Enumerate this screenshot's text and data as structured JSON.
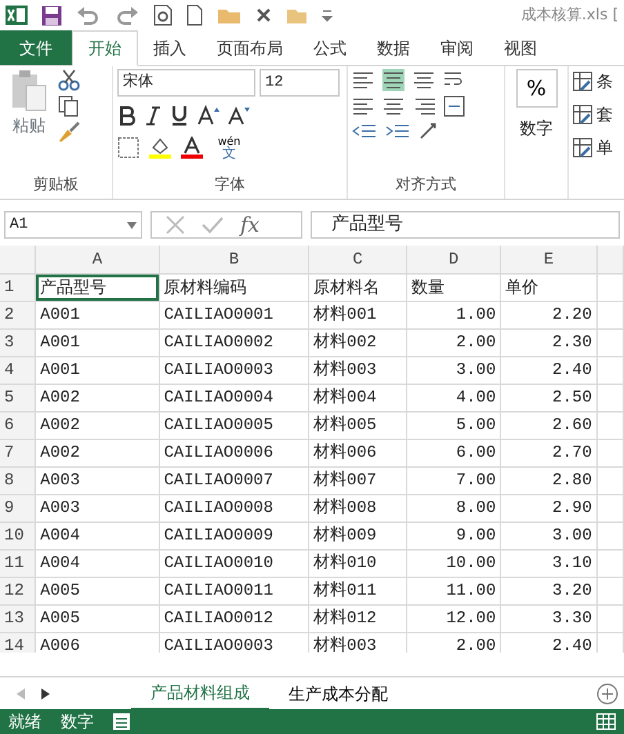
{
  "window": {
    "title": "成本核算.xls ["
  },
  "ribbon_tabs": [
    {
      "label": "文件",
      "kind": "file",
      "selected": false
    },
    {
      "label": "开始",
      "kind": "tab",
      "selected": true
    },
    {
      "label": "插入",
      "kind": "tab",
      "selected": false
    },
    {
      "label": "页面布局",
      "kind": "tab",
      "selected": false
    },
    {
      "label": "公式",
      "kind": "tab",
      "selected": false
    },
    {
      "label": "数据",
      "kind": "tab",
      "selected": false
    },
    {
      "label": "审阅",
      "kind": "tab",
      "selected": false
    },
    {
      "label": "视图",
      "kind": "tab",
      "selected": false
    }
  ],
  "ribbon": {
    "paste_label": "粘贴",
    "font_name": "宋体",
    "font_size": "12",
    "phonetic_label": "wén",
    "phonetic_char": "文",
    "number_symbol": "%",
    "number_label": "数字",
    "styles": [
      "条",
      "套",
      "单"
    ],
    "groups": [
      "剪贴板",
      "字体",
      "对齐方式"
    ]
  },
  "formula_bar": {
    "name_box": "A1",
    "fx": "fx",
    "formula": "产品型号"
  },
  "sheet": {
    "columns": [
      "A",
      "B",
      "C",
      "D",
      "E"
    ],
    "rows": [
      {
        "n": "1",
        "cells": [
          "产品型号",
          "原材料编码",
          "原材料名",
          "数量",
          "单价"
        ]
      },
      {
        "n": "2",
        "cells": [
          "A001",
          "CAILIAO0001",
          "材料001",
          "1.00",
          "2.20"
        ]
      },
      {
        "n": "3",
        "cells": [
          "A001",
          "CAILIAO0002",
          "材料002",
          "2.00",
          "2.30"
        ]
      },
      {
        "n": "4",
        "cells": [
          "A001",
          "CAILIAO0003",
          "材料003",
          "3.00",
          "2.40"
        ]
      },
      {
        "n": "5",
        "cells": [
          "A002",
          "CAILIAO0004",
          "材料004",
          "4.00",
          "2.50"
        ]
      },
      {
        "n": "6",
        "cells": [
          "A002",
          "CAILIAO0005",
          "材料005",
          "5.00",
          "2.60"
        ]
      },
      {
        "n": "7",
        "cells": [
          "A002",
          "CAILIAO0006",
          "材料006",
          "6.00",
          "2.70"
        ]
      },
      {
        "n": "8",
        "cells": [
          "A003",
          "CAILIAO0007",
          "材料007",
          "7.00",
          "2.80"
        ]
      },
      {
        "n": "9",
        "cells": [
          "A003",
          "CAILIAO0008",
          "材料008",
          "8.00",
          "2.90"
        ]
      },
      {
        "n": "10",
        "cells": [
          "A004",
          "CAILIAO0009",
          "材料009",
          "9.00",
          "3.00"
        ]
      },
      {
        "n": "11",
        "cells": [
          "A004",
          "CAILIAO0010",
          "材料010",
          "10.00",
          "3.10"
        ]
      },
      {
        "n": "12",
        "cells": [
          "A005",
          "CAILIAO0011",
          "材料011",
          "11.00",
          "3.20"
        ]
      },
      {
        "n": "13",
        "cells": [
          "A005",
          "CAILIAO0012",
          "材料012",
          "12.00",
          "3.30"
        ]
      },
      {
        "n": "14",
        "cells": [
          "A006",
          "CAILIAO0003",
          "材料003",
          "2.00",
          "2.40"
        ]
      }
    ]
  },
  "sheet_tabs": [
    {
      "label": "产品材料组成",
      "selected": true
    },
    {
      "label": "生产成本分配",
      "selected": false
    }
  ],
  "status_bar": {
    "items": [
      "就绪",
      "数字"
    ]
  }
}
